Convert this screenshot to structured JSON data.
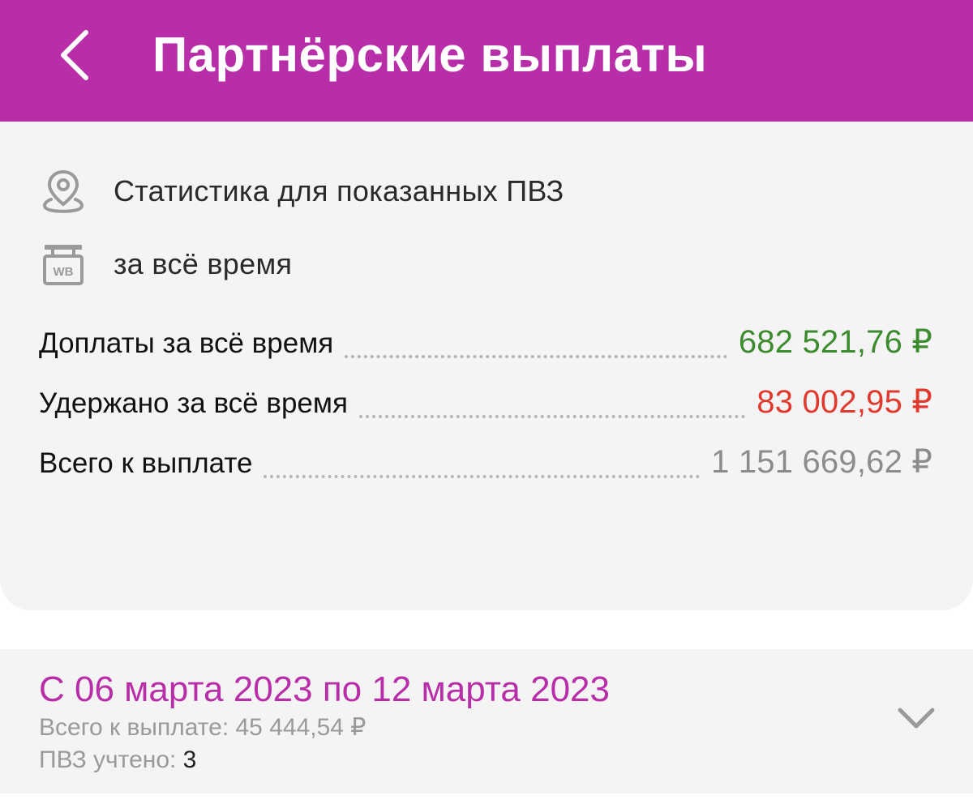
{
  "header": {
    "title": "Партнёрские выплаты",
    "background_color": "#b82ea8"
  },
  "filters": {
    "location_label": "Статистика для показанных ПВЗ",
    "period_label": "за всё время",
    "period_icon_text": "WB"
  },
  "summary": {
    "extra_label": "Доплаты за всё время",
    "extra_value": "682 521,76 ₽",
    "withheld_label": "Удержано за всё время",
    "withheld_value": "83 002,95 ₽",
    "total_label": "Всего к выплате",
    "total_value": "1 151 669,62 ₽"
  },
  "weeks": [
    {
      "title": "С 06 марта 2023 по 12 марта 2023",
      "total_text": "Всего к выплате: 45 444,54 ₽",
      "count_label": "ПВЗ учтено: ",
      "count_value": "3"
    }
  ],
  "colors": {
    "accent": "#b82ea8",
    "positive": "#3d8b2f",
    "negative": "#e0392d",
    "neutral": "#8c8c8c"
  },
  "icons": {
    "back": "chevron-left-icon",
    "location": "map-pin-icon",
    "period": "wb-signboard-icon",
    "expand": "chevron-down-icon"
  }
}
